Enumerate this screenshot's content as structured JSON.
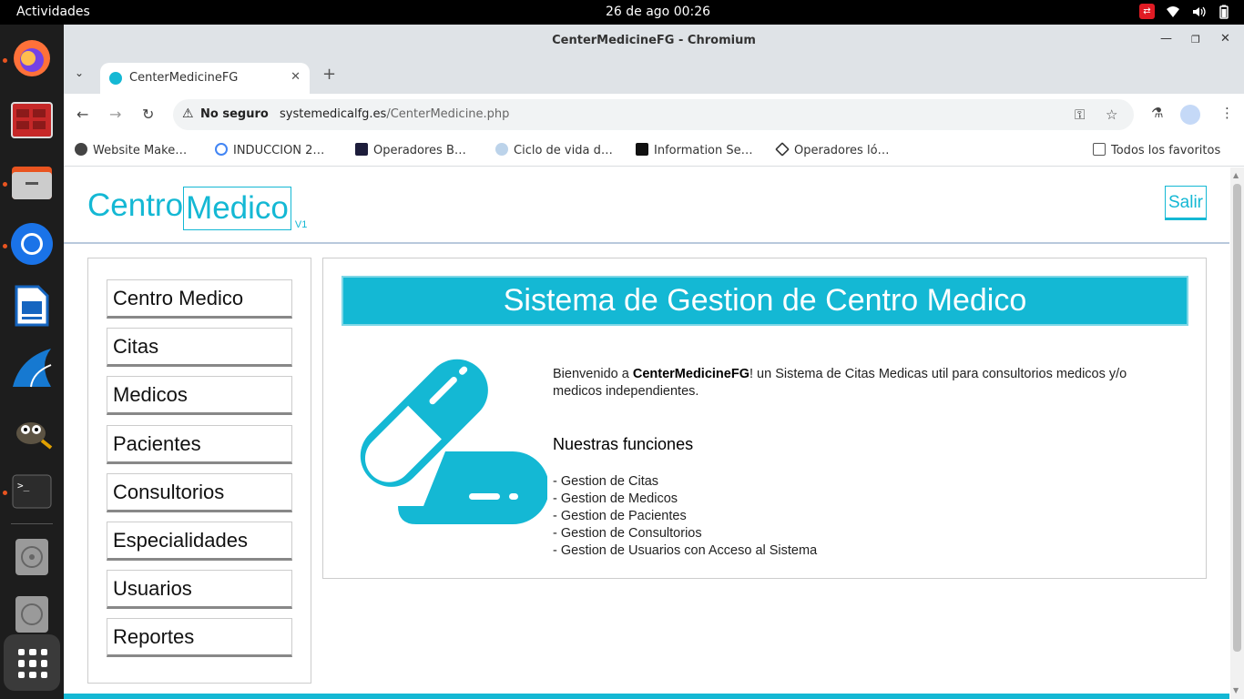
{
  "topbar": {
    "activities": "Actividades",
    "datetime": "26 de ago  00:26"
  },
  "window": {
    "title": "CenterMedicineFG - Chromium"
  },
  "tab": {
    "title": "CenterMedicineFG"
  },
  "omnibox": {
    "security_label": "No seguro",
    "url_host": "systemedicalfg.es",
    "url_path": "/CenterMedicine.php"
  },
  "bookmarks": {
    "items": [
      {
        "label": "Website Make…",
        "icon": "globe-icon"
      },
      {
        "label": "INDUCCION 2…",
        "icon": "google-icon"
      },
      {
        "label": "Operadores B…",
        "icon": "a-logo-icon"
      },
      {
        "label": "Ciclo de vida d…",
        "icon": "cloud-icon"
      },
      {
        "label": "Information Se…",
        "icon": "x-logo-icon"
      },
      {
        "label": "Operadores ló…",
        "icon": "diamond-icon"
      }
    ],
    "all_label": "Todos los favoritos"
  },
  "site": {
    "logo_part1": "Centro",
    "logo_part2": "Medico",
    "logo_version": "V1",
    "logout_label": "Salir",
    "accent_color": "#14b8d4"
  },
  "sidebar": {
    "items": [
      {
        "label": "Centro Medico"
      },
      {
        "label": "Citas"
      },
      {
        "label": "Medicos"
      },
      {
        "label": "Pacientes"
      },
      {
        "label": "Consultorios"
      },
      {
        "label": "Especialidades"
      },
      {
        "label": "Usuarios"
      },
      {
        "label": "Reportes"
      }
    ]
  },
  "main": {
    "banner": "Sistema de Gestion de Centro Medico",
    "welcome_prefix": "Bienvenido a ",
    "welcome_brand": "CenterMedicineFG",
    "welcome_suffix": "! un Sistema de Citas Medicas util para consultorios medicos y/o medicos independientes.",
    "functions_title": "Nuestras funciones",
    "functions": [
      "- Gestion de Citas",
      "- Gestion de Medicos",
      "- Gestion de Pacientes",
      "- Gestion de Consultorios",
      "- Gestion de Usuarios con Acceso al Sistema"
    ]
  }
}
